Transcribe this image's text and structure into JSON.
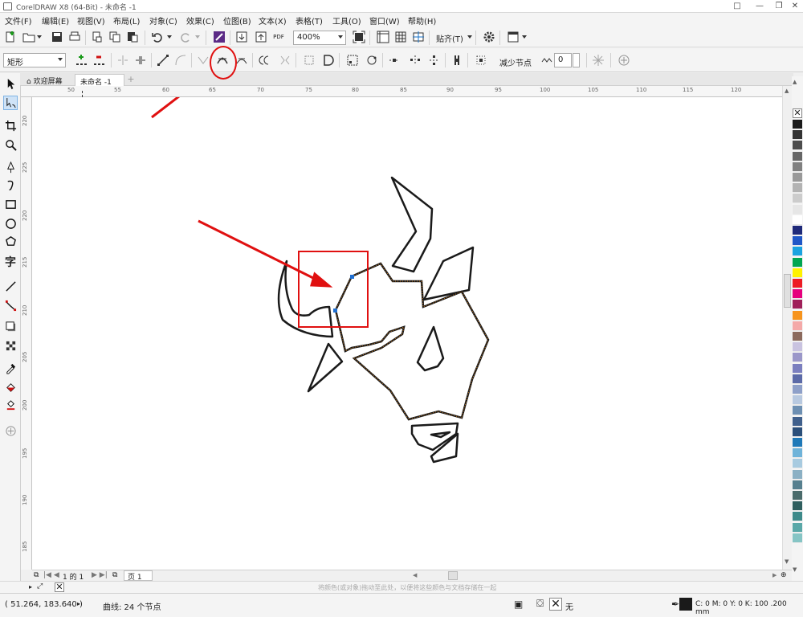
{
  "window": {
    "title": "CorelDRAW X8 (64-Bit) - 未命名 -1"
  },
  "menu": [
    "文件(F)",
    "编辑(E)",
    "视图(V)",
    "布局(L)",
    "对象(C)",
    "效果(C)",
    "位图(B)",
    "文本(X)",
    "表格(T)",
    "工具(O)",
    "窗口(W)",
    "帮助(H)"
  ],
  "toolbar": {
    "zoom": "400%",
    "snap_label": "贴齐(T)",
    "pdf_label": "PDF"
  },
  "property_bar": {
    "shape_select": "矩形",
    "reduce_nodes": "减少节点",
    "smoothness": "0"
  },
  "tabs": {
    "welcome": "欢迎屏幕",
    "document": "未命名 -1"
  },
  "ruler": {
    "h_ticks": [
      "50",
      "55",
      "60",
      "65",
      "70",
      "75",
      "80",
      "85",
      "90",
      "95",
      "100",
      "105",
      "110",
      "115",
      "120"
    ],
    "v_ticks": [
      "220",
      "225",
      "220",
      "215",
      "210",
      "205",
      "200",
      "195",
      "190",
      "185"
    ]
  },
  "page_nav": {
    "page_count": "1 的 1",
    "page_tab": "页 1"
  },
  "hint": "将颜色(或对象)拖动至此处，以便将这些颜色与文档存储在一起",
  "status": {
    "coords": "( 51.264, 183.640 )",
    "object_info": "曲线: 24 个节点",
    "fill_label": "无",
    "outline_info": "C: 0 M: 0 Y: 0 K: 100  .200 mm"
  },
  "palette_colors": [
    "#1a1a1a",
    "#333333",
    "#4d4d4d",
    "#666666",
    "#808080",
    "#999999",
    "#b3b3b3",
    "#cccccc",
    "#e6e6e6",
    "#ffffff",
    "#1f2a7a",
    "#1f57c7",
    "#1aa3e0",
    "#00a651",
    "#fff200",
    "#ed1c24",
    "#e6007e",
    "#a0205a",
    "#f7941d",
    "#f4a9a8",
    "#8c6a5d",
    "#c9c3e0",
    "#9b97c9",
    "#7b7fbf",
    "#5b6aa8",
    "#8ea0c9",
    "#b8c9e0",
    "#6d8fb2",
    "#40608c",
    "#2b4f7a",
    "#1f79b8",
    "#6fb3d9",
    "#a8cbe0",
    "#8bb0c4",
    "#57808f",
    "#4a6b6b",
    "#2f5f5f",
    "#3d8a8a",
    "#5aa8a8",
    "#86c5c5"
  ]
}
